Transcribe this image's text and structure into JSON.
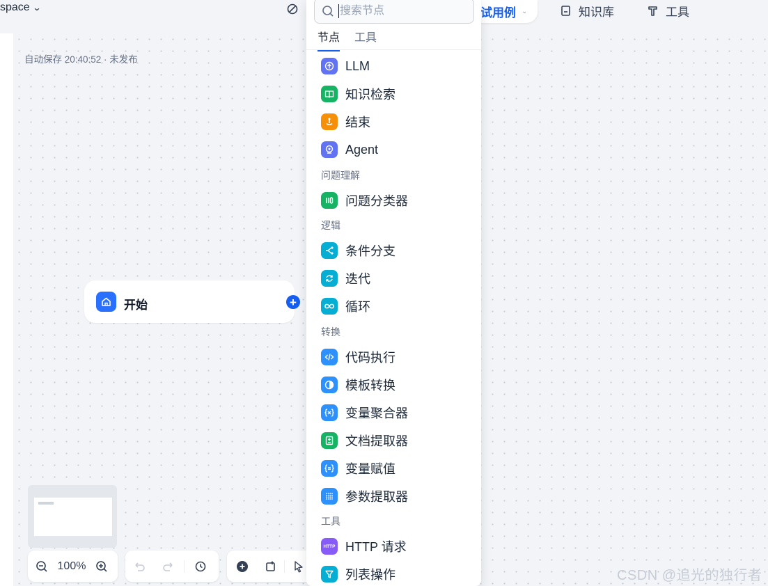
{
  "topbar": {
    "workspace_label": "space",
    "test_case_label": "试用例",
    "nav": [
      {
        "label": "知识库",
        "icon": "book-icon"
      },
      {
        "label": "工具",
        "icon": "hammer-icon"
      }
    ]
  },
  "canvas": {
    "autosave_status": "自动保存 20:40:52 · 未发布",
    "start_node_label": "开始"
  },
  "zoom": {
    "level": "100%"
  },
  "node_picker": {
    "search_placeholder": "搜索节点",
    "tabs": [
      "节点",
      "工具"
    ],
    "active_tab": "节点",
    "groups": [
      {
        "title": "",
        "items": [
          {
            "label": "LLM",
            "icon": "llm-icon",
            "color": "#6172f3"
          },
          {
            "label": "知识检索",
            "icon": "knowledge-retrieval-icon",
            "color": "#16b364"
          },
          {
            "label": "结束",
            "icon": "end-icon",
            "color": "#f79009"
          },
          {
            "label": "Agent",
            "icon": "agent-icon",
            "color": "#6172f3"
          }
        ]
      },
      {
        "title": "问题理解",
        "items": [
          {
            "label": "问题分类器",
            "icon": "question-classifier-icon",
            "color": "#16b364"
          }
        ]
      },
      {
        "title": "逻辑",
        "items": [
          {
            "label": "条件分支",
            "icon": "if-else-icon",
            "color": "#06aed4"
          },
          {
            "label": "迭代",
            "icon": "iteration-icon",
            "color": "#06aed4"
          },
          {
            "label": "循环",
            "icon": "loop-icon",
            "color": "#06aed4"
          }
        ]
      },
      {
        "title": "转换",
        "items": [
          {
            "label": "代码执行",
            "icon": "code-icon",
            "color": "#2e90fa"
          },
          {
            "label": "模板转换",
            "icon": "template-icon",
            "color": "#2e90fa"
          },
          {
            "label": "变量聚合器",
            "icon": "variable-aggregator-icon",
            "color": "#2e90fa"
          },
          {
            "label": "文档提取器",
            "icon": "doc-extractor-icon",
            "color": "#16b364"
          },
          {
            "label": "变量赋值",
            "icon": "variable-assign-icon",
            "color": "#2e90fa"
          },
          {
            "label": "参数提取器",
            "icon": "parameter-extractor-icon",
            "color": "#2e90fa"
          }
        ]
      },
      {
        "title": "工具",
        "items": [
          {
            "label": "HTTP 请求",
            "icon": "http-icon",
            "color": "#875bf7",
            "icon_text": "HTTP"
          },
          {
            "label": "列表操作",
            "icon": "list-operator-icon",
            "color": "#06aed4"
          }
        ]
      }
    ]
  },
  "watermark": "CSDN @追光的独行者"
}
